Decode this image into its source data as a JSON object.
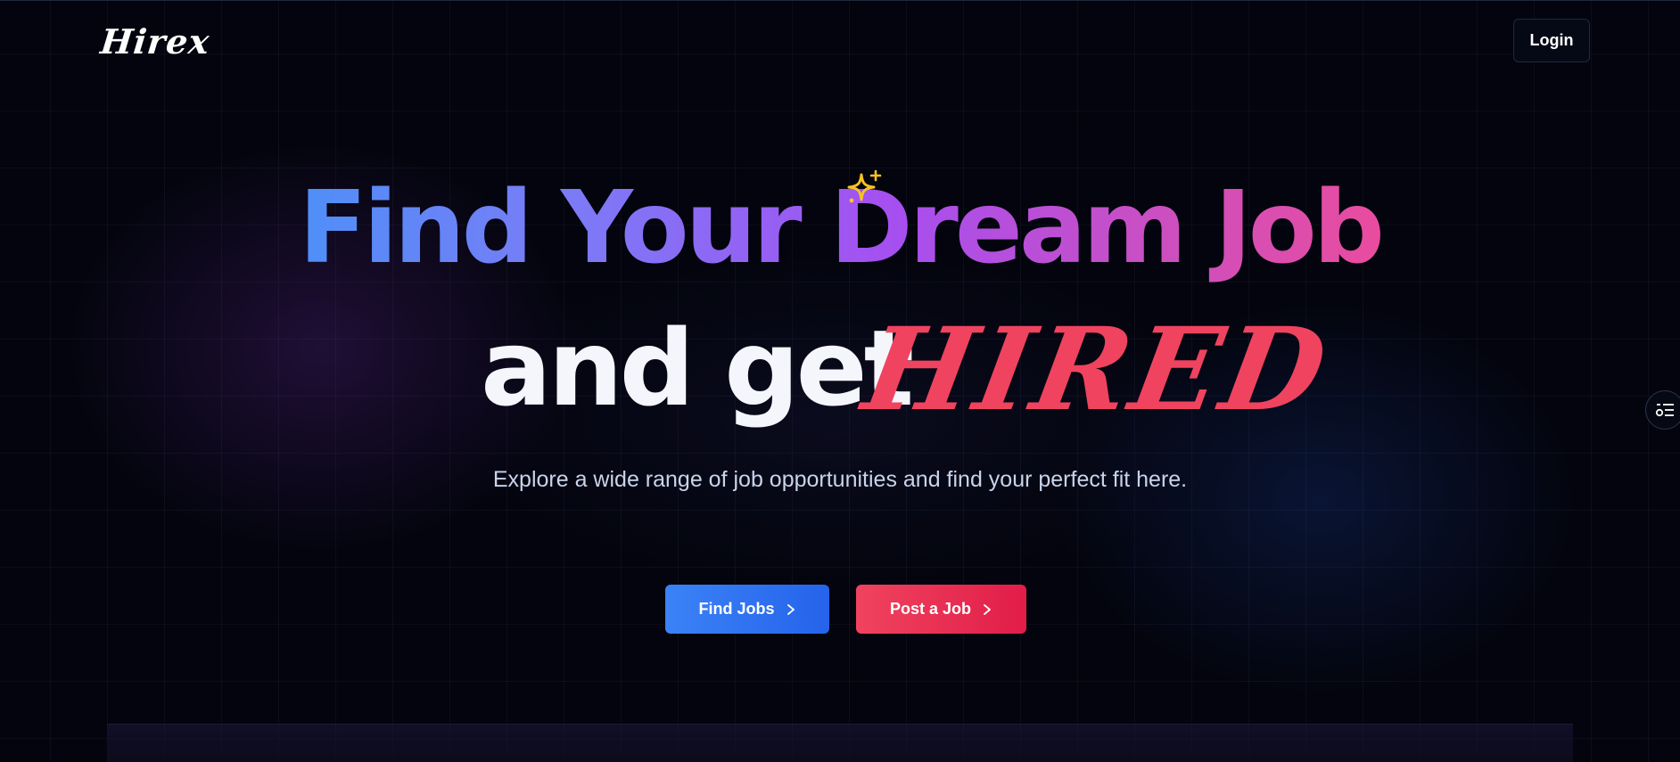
{
  "header": {
    "logo_text": "Hirex",
    "login_label": "Login"
  },
  "hero": {
    "title_line1": "Find Your Dream Job",
    "title_line2_prefix": "and get",
    "title_line2_highlight": "HIRED",
    "subtitle": "Explore a wide range of job opportunities and find your perfect fit here."
  },
  "actions": {
    "find_jobs_label": "Find Jobs",
    "post_job_label": "Post a Job"
  },
  "icons": {
    "sparkle": "sparkle-icon",
    "chevron": "chevron-right-icon",
    "side_widget": "filter-list-icon"
  },
  "colors": {
    "background": "#03040d",
    "gradient_start": "#4f8ff7",
    "gradient_mid": "#a64ff0",
    "gradient_end": "#e94c9e",
    "accent_red": "#f0435f",
    "accent_blue": "#3b82f6",
    "sparkle": "#f7c325"
  }
}
